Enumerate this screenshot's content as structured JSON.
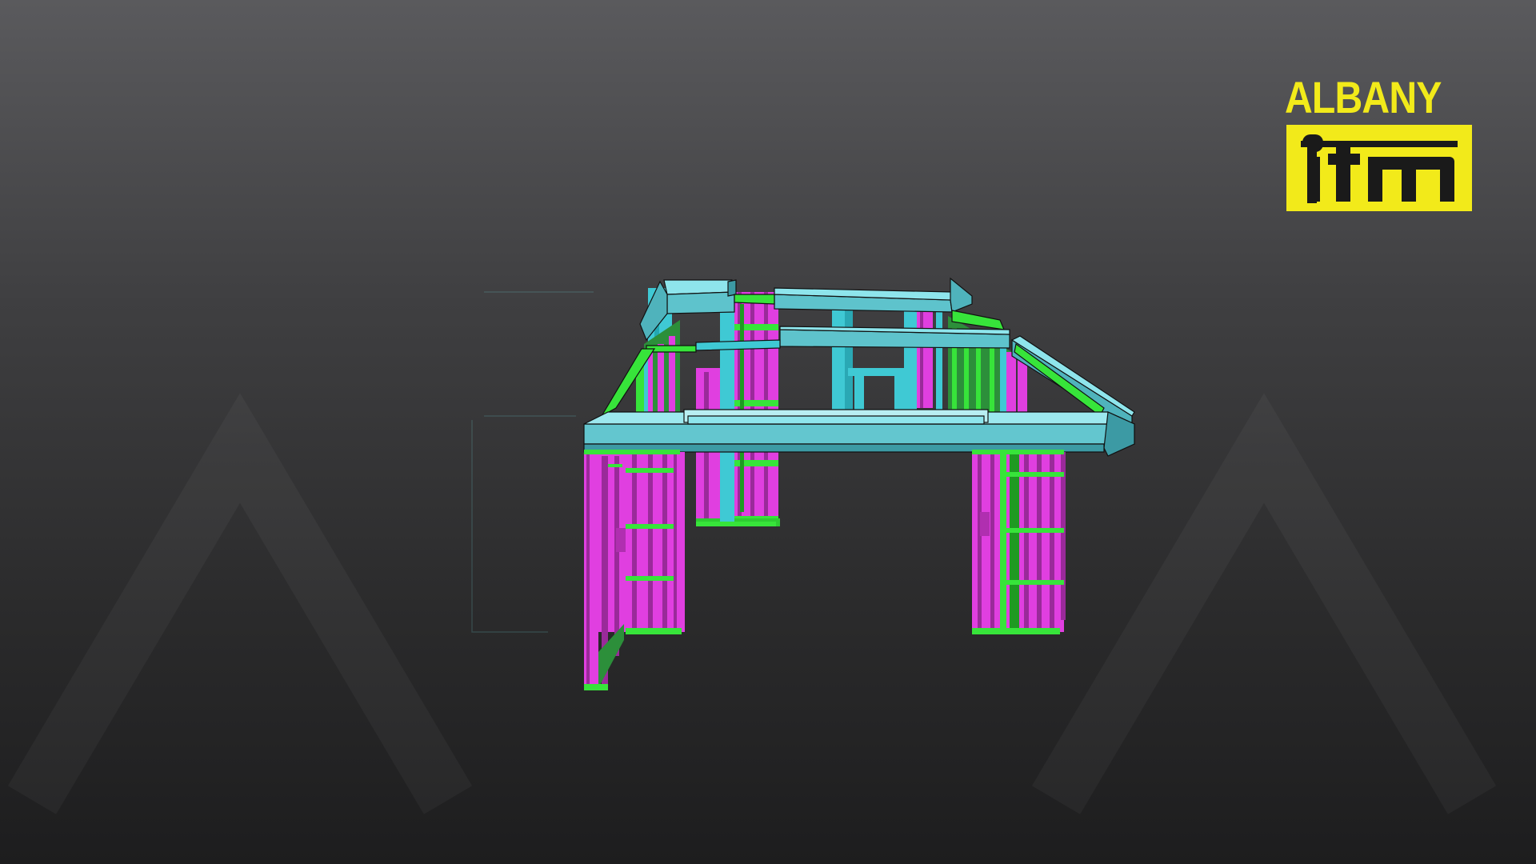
{
  "brand": {
    "word": "ALBANY",
    "mark": "itm",
    "color": "#f2ea1a"
  },
  "colors": {
    "beam": "#63c6cf",
    "beam_dark": "#3c9aa4",
    "stud": "#e03fe0",
    "stud_dark": "#9a2a9a",
    "plate": "#37e43a",
    "plate_dark": "#1f9a22",
    "edge": "#111111"
  },
  "scene": {
    "icon": "timber-frame-model"
  }
}
